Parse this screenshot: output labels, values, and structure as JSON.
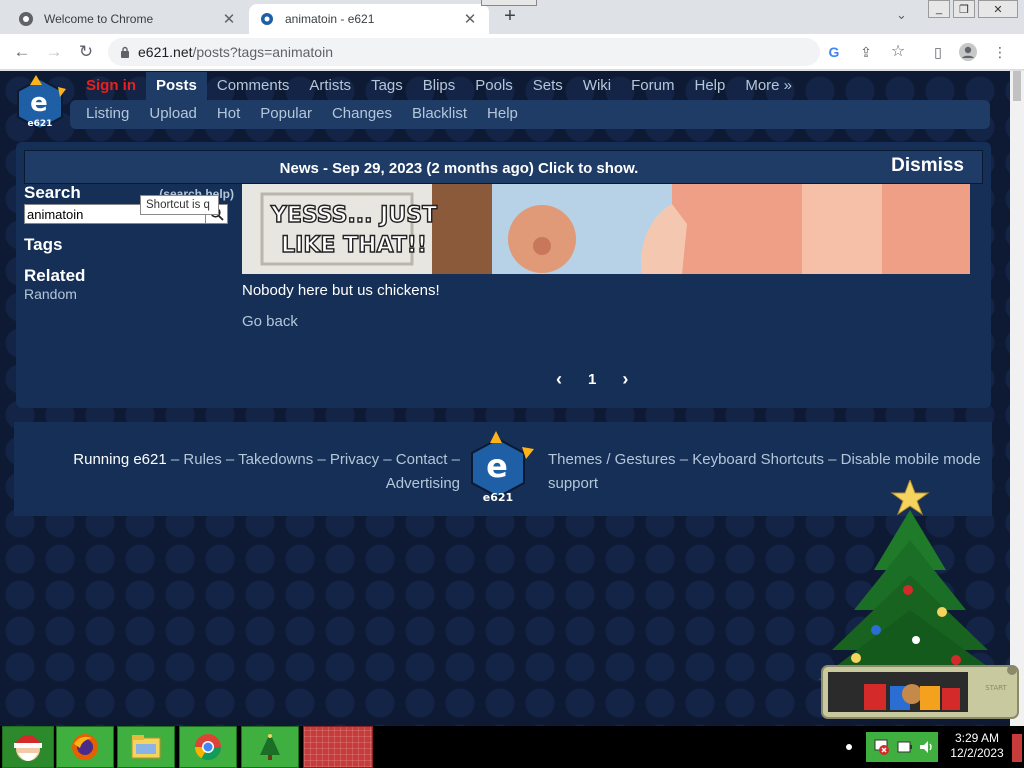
{
  "browser": {
    "tabs": [
      {
        "title": "Welcome to Chrome",
        "active": false
      },
      {
        "title": "animatoin - e621",
        "active": true
      }
    ],
    "url_host": "e621.net",
    "url_path": "/posts?tags=animatoin"
  },
  "site": {
    "main_nav": [
      "Sign in",
      "Posts",
      "Comments",
      "Artists",
      "Tags",
      "Blips",
      "Pools",
      "Sets",
      "Wiki",
      "Forum",
      "Help",
      "More »"
    ],
    "sub_nav": [
      "Listing",
      "Upload",
      "Hot",
      "Popular",
      "Changes",
      "Blacklist",
      "Help"
    ],
    "logo_text": "e621"
  },
  "news": {
    "text": "News - Sep 29, 2023 (2 months ago) Click to show.",
    "dismiss": "Dismiss"
  },
  "sidebar": {
    "search_heading": "Search",
    "search_help": "(search help)",
    "search_value": "animatoin",
    "tooltip": "Shortcut is q",
    "tags_heading": "Tags",
    "related_heading": "Related",
    "random_link": "Random"
  },
  "results": {
    "mascot_caption_line1": "YESSS... JUST",
    "mascot_caption_line2": "LIKE THAT!!",
    "empty_message": "Nobody here but us chickens!",
    "go_back": "Go back",
    "prev": "‹",
    "page": "1",
    "next": "›"
  },
  "footer": {
    "running": "Running e621",
    "rules": "Rules",
    "takedowns": "Takedowns",
    "privacy": "Privacy",
    "contact": "Contact",
    "advertising": "Advertising",
    "themes": "Themes / Gestures",
    "keyboard": "Keyboard Shortcuts",
    "disable_mobile": "Disable mobile mode",
    "support": "support",
    "sep": "–"
  },
  "taskbar": {
    "time": "3:29 AM",
    "date": "12/2/2023",
    "gadget_label": "START"
  },
  "colors": {
    "page_bg": "#0e1a33",
    "panel": "#152f56",
    "nav_active": "#1f3c67",
    "link": "#b4c7d9",
    "signin": "#e8201b",
    "taskbar_green": "#3fb03f"
  }
}
